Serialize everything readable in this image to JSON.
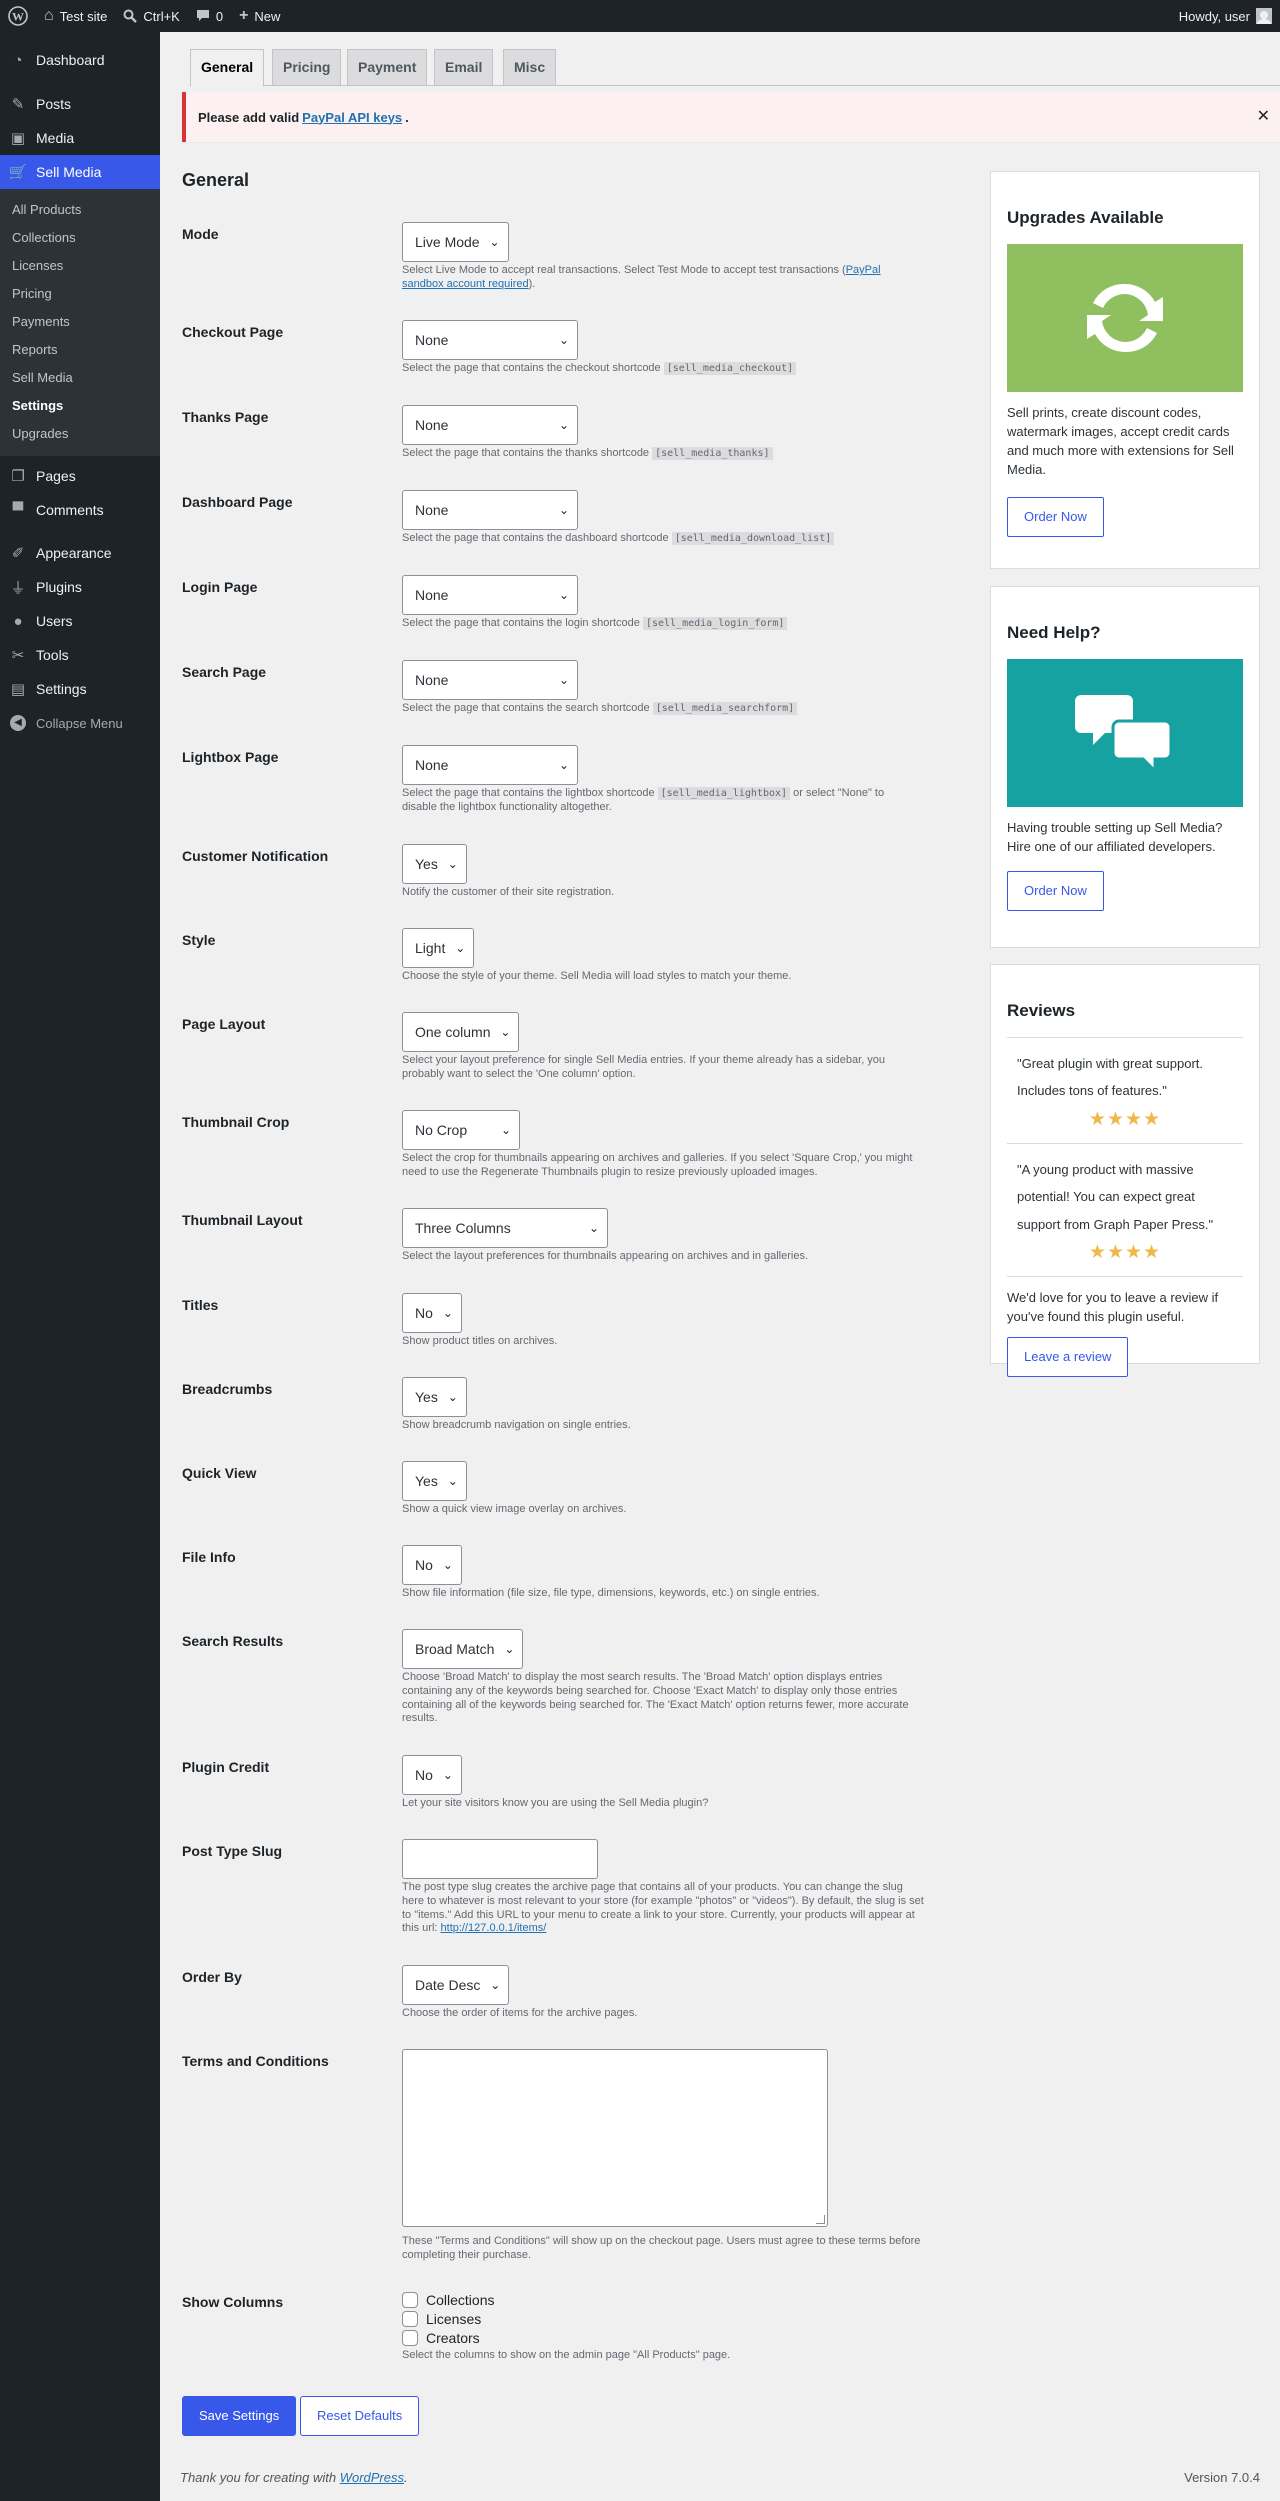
{
  "adminbar": {
    "site_name": "Test site",
    "search_shortcut": "Ctrl+K",
    "comments_count": "0",
    "new_label": "New",
    "howdy": "Howdy, user"
  },
  "sidebar": {
    "items": [
      {
        "label": "Dashboard",
        "icon": "dashboard-icon"
      },
      {
        "label": "Posts",
        "icon": "pushpin-icon"
      },
      {
        "label": "Media",
        "icon": "media-icon"
      },
      {
        "label": "Sell Media",
        "icon": "cart-icon"
      },
      {
        "label": "Pages",
        "icon": "pages-icon"
      },
      {
        "label": "Comments",
        "icon": "comment-icon"
      },
      {
        "label": "Appearance",
        "icon": "paintbrush-icon"
      },
      {
        "label": "Plugins",
        "icon": "plugin-icon"
      },
      {
        "label": "Users",
        "icon": "user-icon"
      },
      {
        "label": "Tools",
        "icon": "wrench-icon"
      },
      {
        "label": "Settings",
        "icon": "settings-icon"
      },
      {
        "label": "Collapse Menu",
        "icon": "collapse-icon"
      }
    ],
    "submenu": [
      "All Products",
      "Collections",
      "Licenses",
      "Pricing",
      "Payments",
      "Reports",
      "Sell Media",
      "Settings",
      "Upgrades"
    ]
  },
  "tabs": [
    "General",
    "Pricing",
    "Payment",
    "Email",
    "Misc"
  ],
  "notice": {
    "prefix": "Please add valid",
    "link": "PayPal API keys",
    "suffix": ".",
    "close": "✕"
  },
  "section_title": "General",
  "fields": {
    "mode": {
      "label": "Mode",
      "value": "Live Mode",
      "desc": "Select Live Mode to accept real transactions. Select Test Mode to accept test transactions (",
      "desc_link": "PayPal sandbox account required",
      "desc_end": ")."
    },
    "checkout": {
      "label": "Checkout Page",
      "value": "None",
      "desc": "Select the page that contains the checkout shortcode",
      "code": "[sell_media_checkout]"
    },
    "thanks": {
      "label": "Thanks Page",
      "value": "None",
      "desc": "Select the page that contains the thanks shortcode",
      "code": "[sell_media_thanks]"
    },
    "dashboard": {
      "label": "Dashboard Page",
      "value": "None",
      "desc": "Select the page that contains the dashboard shortcode",
      "code": "[sell_media_download_list]"
    },
    "login": {
      "label": "Login Page",
      "value": "None",
      "desc": "Select the page that contains the login shortcode",
      "code": "[sell_media_login_form]"
    },
    "search": {
      "label": "Search Page",
      "value": "None",
      "desc": "Select the page that contains the search shortcode",
      "code": "[sell_media_searchform]"
    },
    "lightbox": {
      "label": "Lightbox Page",
      "value": "None",
      "desc": "Select the page that contains the lightbox shortcode",
      "code": "[sell_media_lightbox]",
      "desc_end": "or select \"None\" to disable the lightbox functionality altogether."
    },
    "customer_notification": {
      "label": "Customer Notification",
      "value": "Yes",
      "desc": "Notify the customer of their site registration."
    },
    "style": {
      "label": "Style",
      "value": "Light",
      "desc": "Choose the style of your theme. Sell Media will load styles to match your theme."
    },
    "page_layout": {
      "label": "Page Layout",
      "value": "One column",
      "desc": "Select your layout preference for single Sell Media entries. If your theme already has a sidebar, you probably want to select the 'One column' option."
    },
    "thumbnail_crop": {
      "label": "Thumbnail Crop",
      "value": "No Crop",
      "desc": "Select the crop for thumbnails appearing on archives and galleries. If you select 'Square Crop,' you might need to use the Regenerate Thumbnails plugin to resize previously uploaded images."
    },
    "thumbnail_layout": {
      "label": "Thumbnail Layout",
      "value": "Three Columns",
      "desc": "Select the layout preferences for thumbnails appearing on archives and in galleries."
    },
    "titles": {
      "label": "Titles",
      "value": "No",
      "desc": "Show product titles on archives."
    },
    "breadcrumbs": {
      "label": "Breadcrumbs",
      "value": "Yes",
      "desc": "Show breadcrumb navigation on single entries."
    },
    "quick_view": {
      "label": "Quick View",
      "value": "Yes",
      "desc": "Show a quick view image overlay on archives."
    },
    "file_info": {
      "label": "File Info",
      "value": "No",
      "desc": "Show file information (file size, file type, dimensions, keywords, etc.) on single entries."
    },
    "search_results": {
      "label": "Search Results",
      "value": "Broad Match",
      "desc": "Choose 'Broad Match' to display the most search results. The 'Broad Match' option displays entries containing any of the keywords being searched for. Choose 'Exact Match' to display only those entries containing all of the keywords being searched for. The 'Exact Match' option returns fewer, more accurate results."
    },
    "plugin_credit": {
      "label": "Plugin Credit",
      "value": "No",
      "desc": "Let your site visitors know you are using the Sell Media plugin?"
    },
    "post_type_slug": {
      "label": "Post Type Slug",
      "value": "",
      "desc": "The post type slug creates the archive page that contains all of your products. You can change the slug here to whatever is most relevant to your store (for example \"photos\" or \"videos\"). By default, the slug is set to \"items.\" Add this URL to your menu to create a link to your store. Currently, your products will appear at this url:",
      "desc_link": "http://127.0.0.1/items/"
    },
    "order_by": {
      "label": "Order By",
      "value": "Date Desc",
      "desc": "Choose the order of items for the archive pages."
    },
    "terms": {
      "label": "Terms and Conditions",
      "value": "",
      "desc": "These \"Terms and Conditions\" will show up on the checkout page. Users must agree to these terms before completing their purchase."
    },
    "show_columns": {
      "label": "Show Columns",
      "options": [
        "Collections",
        "Licenses",
        "Creators"
      ],
      "desc": "Select the columns to show on the admin page \"All Products\" page."
    }
  },
  "buttons": {
    "save": "Save Settings",
    "reset": "Reset Defaults"
  },
  "footer": {
    "prefix": "Thank you for creating with",
    "link": "WordPress",
    "suffix": ".",
    "version": "Version 7.0.4"
  },
  "boxes": {
    "upgrades": {
      "title": "Upgrades Available",
      "text": "Sell prints, create discount codes, watermark images, accept credit cards and much more with extensions for Sell Media.",
      "button": "Order Now",
      "image_color": "#8fbf5f"
    },
    "help": {
      "title": "Need Help?",
      "text": "Having trouble setting up Sell Media? Hire one of our affiliated developers.",
      "button": "Order Now",
      "image_color": "#17a2a2"
    },
    "reviews": {
      "title": "Reviews",
      "items": [
        {
          "quote": "\"Great plugin with great support. Includes tons of features.\"",
          "stars": "★★★★"
        },
        {
          "quote": "\"A young product with massive potential! You can expect great support from Graph Paper Press.\"",
          "stars": "★★★★"
        }
      ],
      "text": "We'd love for you to leave a review if you've found this plugin useful.",
      "button": "Leave a review"
    }
  }
}
